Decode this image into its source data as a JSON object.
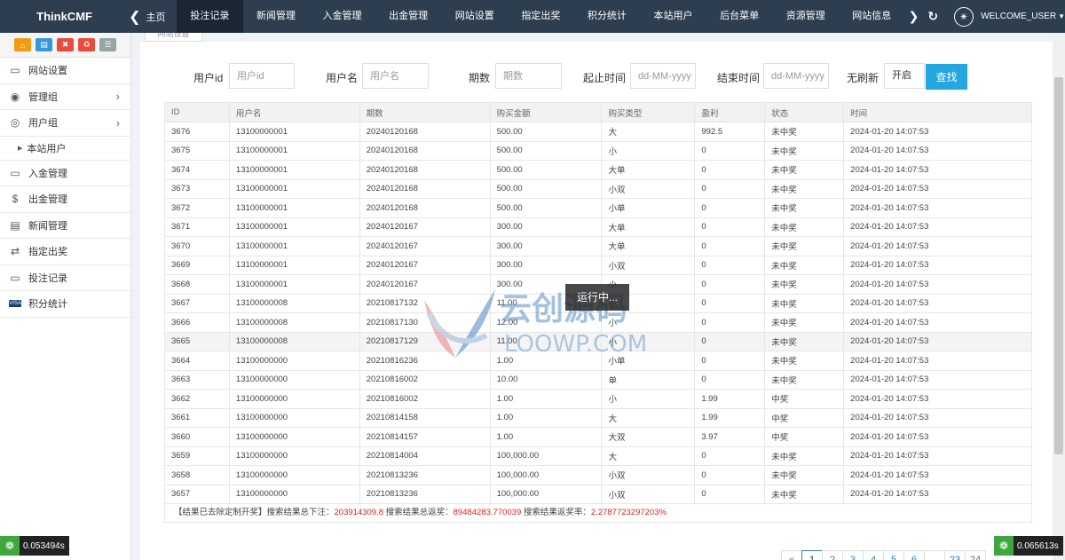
{
  "brand": "ThinkCMF",
  "nav_back": "主页",
  "nav_items": [
    "投注记录",
    "新闻管理",
    "入金管理",
    "出金管理",
    "网站设置",
    "指定出奖",
    "积分统计",
    "本站用户",
    "后台菜单",
    "资源管理",
    "网站信息"
  ],
  "nav_active_index": 0,
  "user_label": "WELCOME_USER",
  "sidebar": {
    "items": [
      {
        "label": "网站设置",
        "icon": "monitor-icon"
      },
      {
        "label": "管理组",
        "icon": "user-circle-icon",
        "arrow": true
      },
      {
        "label": "用户组",
        "icon": "user-icon",
        "arrow": true
      },
      {
        "label": "入金管理",
        "icon": "monitor-icon"
      },
      {
        "label": "出金管理",
        "icon": "dollar-icon"
      },
      {
        "label": "新闻管理",
        "icon": "newspaper-icon"
      },
      {
        "label": "指定出奖",
        "icon": "exchange-icon"
      },
      {
        "label": "投注记录",
        "icon": "monitor-icon"
      },
      {
        "label": "积分统计",
        "icon": "visa-icon"
      }
    ],
    "sub_item": "本站用户"
  },
  "tab_label": "网站设置",
  "filters": {
    "user_id": {
      "label": "用户id",
      "placeholder": "用户id"
    },
    "username": {
      "label": "用户名",
      "placeholder": "用户名"
    },
    "period": {
      "label": "期数",
      "placeholder": "期数"
    },
    "start_time": {
      "label": "起止时间",
      "placeholder": "dd-MM-yyyy"
    },
    "end_time": {
      "label": "结束时间",
      "placeholder": "dd-MM-yyyy"
    },
    "no_refresh": {
      "label": "无刷新",
      "value": "开启"
    },
    "search_button": "查找"
  },
  "table": {
    "headers": [
      "ID",
      "用户名",
      "期数",
      "购买金额",
      "购买类型",
      "盈利",
      "状态",
      "时间"
    ],
    "rows": [
      [
        "3676",
        "13100000001",
        "20240120168",
        "500.00",
        "大",
        "992.5",
        "未中奖",
        "2024-01-20 14:07:53"
      ],
      [
        "3675",
        "13100000001",
        "20240120168",
        "500.00",
        "小",
        "0",
        "未中奖",
        "2024-01-20 14:07:53"
      ],
      [
        "3674",
        "13100000001",
        "20240120168",
        "500.00",
        "大单",
        "0",
        "未中奖",
        "2024-01-20 14:07:53"
      ],
      [
        "3673",
        "13100000001",
        "20240120168",
        "500.00",
        "小双",
        "0",
        "未中奖",
        "2024-01-20 14:07:53"
      ],
      [
        "3672",
        "13100000001",
        "20240120168",
        "500.00",
        "小单",
        "0",
        "未中奖",
        "2024-01-20 14:07:53"
      ],
      [
        "3671",
        "13100000001",
        "20240120167",
        "300.00",
        "大单",
        "0",
        "未中奖",
        "2024-01-20 14:07:53"
      ],
      [
        "3670",
        "13100000001",
        "20240120167",
        "300.00",
        "大单",
        "0",
        "未中奖",
        "2024-01-20 14:07:53"
      ],
      [
        "3669",
        "13100000001",
        "20240120167",
        "300.00",
        "小双",
        "0",
        "未中奖",
        "2024-01-20 14:07:53"
      ],
      [
        "3668",
        "13100000001",
        "20240120167",
        "300.00",
        "小",
        "0",
        "未中奖",
        "2024-01-20 14:07:53"
      ],
      [
        "3667",
        "13100000008",
        "20210817132",
        "11.00",
        "小",
        "0",
        "未中奖",
        "2024-01-20 14:07:53"
      ],
      [
        "3666",
        "13100000008",
        "20210817130",
        "12.00",
        "小",
        "0",
        "未中奖",
        "2024-01-20 14:07:53"
      ],
      [
        "3665",
        "13100000008",
        "20210817129",
        "11.00",
        "小",
        "0",
        "未中奖",
        "2024-01-20 14:07:53"
      ],
      [
        "3664",
        "13100000000",
        "20210816236",
        "1.00",
        "小单",
        "0",
        "未中奖",
        "2024-01-20 14:07:53"
      ],
      [
        "3663",
        "13100000000",
        "20210816002",
        "10.00",
        "单",
        "0",
        "未中奖",
        "2024-01-20 14:07:53"
      ],
      [
        "3662",
        "13100000000",
        "20210816002",
        "1.00",
        "小",
        "1.99",
        "中奖",
        "2024-01-20 14:07:53"
      ],
      [
        "3661",
        "13100000000",
        "20210814158",
        "1.00",
        "大",
        "1.99",
        "中奖",
        "2024-01-20 14:07:53"
      ],
      [
        "3660",
        "13100000000",
        "20210814157",
        "1.00",
        "大双",
        "3.97",
        "中奖",
        "2024-01-20 14:07:53"
      ],
      [
        "3659",
        "13100000000",
        "20210814004",
        "100,000.00",
        "大",
        "0",
        "未中奖",
        "2024-01-20 14:07:53"
      ],
      [
        "3658",
        "13100000000",
        "20210813236",
        "100,000.00",
        "小双",
        "0",
        "未中奖",
        "2024-01-20 14:07:53"
      ],
      [
        "3657",
        "13100000000",
        "20210813236",
        "100,000.00",
        "小双",
        "0",
        "未中奖",
        "2024-01-20 14:07:53"
      ]
    ],
    "highlight_row_index": 11,
    "win_status": "中奖"
  },
  "summary": {
    "prefix": "【结果已去除定制开奖】搜索结果总下注：",
    "total_bet": "203914309.8",
    "return_label": " 搜索结果总返奖：",
    "total_return": "89484283.770039",
    "rate_label": " 搜索结果返奖率：",
    "rate": "2.2787723297203%"
  },
  "pager": [
    "«",
    "1",
    "2",
    "3",
    "4",
    "5",
    "6",
    "...",
    "23",
    "24"
  ],
  "pager_active_index": 1,
  "loading_text": "运行中...",
  "watermark": {
    "cn": "云创源码",
    "en": "LOOWP.COM"
  },
  "timers": {
    "left": "0.053494s",
    "right": "0.065613s"
  },
  "colors": {
    "topbar": "#2c3e50",
    "accent": "#22a7e0",
    "win": "#e02020"
  }
}
